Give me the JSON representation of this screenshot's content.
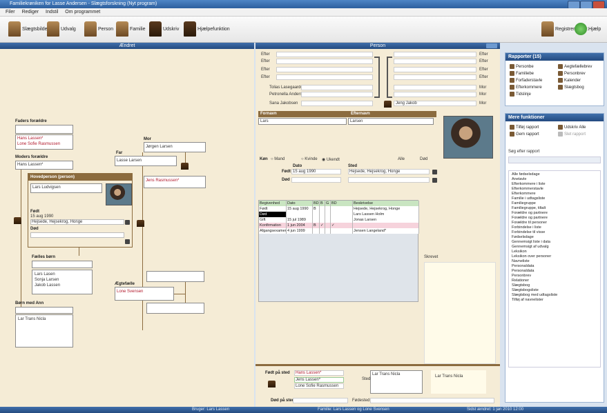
{
  "window": {
    "title": "Familiekrøniken for Lasse Andersen - Slægtsforskning (Nyt program)"
  },
  "menu": [
    "Filer",
    "Rediger",
    "Indstil",
    "Om programmet"
  ],
  "toolbar": {
    "items": [
      {
        "label": "Slægtsbilde",
        "icon": "family-tree-icon"
      },
      {
        "label": "Udvalg",
        "icon": "person-group-icon"
      },
      {
        "label": "Person",
        "icon": "person-icon"
      },
      {
        "label": "Familie",
        "icon": "family-icon"
      },
      {
        "label": "Udskriv",
        "icon": "print-icon"
      },
      {
        "label": "Hjælpefunktion",
        "icon": "help-book-icon"
      }
    ],
    "right_items": [
      {
        "label": "Registrer ændr.",
        "icon": "register-icon"
      },
      {
        "label": "Hjælp",
        "icon": "green-help-icon"
      }
    ]
  },
  "left_panel": {
    "header": "Ændret",
    "father_parents_label": "Faders forældre",
    "father_parents": {
      "empty": "",
      "child_line1": "Hans Lassen*",
      "child_line2": "Lone Sofie Rasmussen"
    },
    "mother_parents_label": "Moders forældre",
    "mother_parents_value": "Hans Lassen*",
    "mother_label": "Mor",
    "mother_name": "Jørgen Larsen",
    "father_label": "Far",
    "father_name": "Lasse Larsen",
    "partner_top_name": "Jens Rasmussen*",
    "focus_header": "Hovedperson (person)",
    "focus_name": "Lars Ludvigsen",
    "born_label": "Født",
    "born_value": "15 aug 1990",
    "born_place": "Hejsede, Hejsekrog, Honge",
    "died_label": "Død",
    "children_label": "Fælles børn",
    "children": [
      "Lars Lasen",
      "Sonja Larsen",
      "Jakob Lassen"
    ],
    "partner_label": "Ægtefælle",
    "partner_name": "Lone Svensen",
    "siblings_label": "Børn med Ann",
    "siblings": [
      "Lar Trans Nicla"
    ]
  },
  "center_panel": {
    "header": "Person",
    "name_fields": [
      {
        "label": "Efter",
        "right": "Efter"
      },
      {
        "label": "Efter",
        "right": "Efter"
      },
      {
        "label": "Efter",
        "right": "Efter"
      },
      {
        "label": "Efter",
        "right": "Efter"
      }
    ],
    "couple_rows": [
      {
        "left": "Tolias Lasegaarde",
        "right": "Mor"
      },
      {
        "left": "Petronella Andersen",
        "right": "Mor"
      }
    ],
    "partner_field": "Sana Jakobsen",
    "partner_right": "Jeng Jakob",
    "partner_right2": "Mor",
    "first_name_label": "Fornavn",
    "first_name_value": "Lars",
    "last_name_label": "Efternavn",
    "last_name_value": "Larsen",
    "sex_label": "Køn",
    "sex_options": [
      "Mand",
      "Kvinde",
      "Ukendt"
    ],
    "sex_selected": "Ukendt",
    "alive_label": "Alle",
    "alive_value": "Død",
    "date_label": "Dato",
    "born_label": "Født",
    "born_value": "15 aug 1990",
    "place_label": "Sted",
    "place_value": "Hejsede, Hejsekrog, Honge",
    "died_label": "Død",
    "events_headers": [
      "Begivenhed",
      "Dato",
      "BDS",
      "B",
      "G",
      "BD",
      "Beskrivelse"
    ],
    "events": [
      {
        "type": "Født",
        "date": "15 aug 1990",
        "c1": "B",
        "c2": "",
        "c3": "",
        "c4": "",
        "desc": "Hejsede, Hejsekrog, Honge",
        "style": "normal"
      },
      {
        "type": "Død",
        "date": "",
        "c1": "",
        "c2": "",
        "c3": "",
        "c4": "",
        "desc": "Lars Lassen Holm",
        "style": "selected"
      },
      {
        "type": "Gift",
        "date": "15 jul 1989",
        "c1": "",
        "c2": "",
        "c3": "",
        "c4": "",
        "desc": "Jonas Larsen",
        "style": "normal"
      },
      {
        "type": "Konfirmation",
        "date": "1 jun 2004",
        "c1": "B",
        "c2": "✓",
        "c3": "",
        "c4": "✓",
        "desc": "",
        "style": "pink"
      },
      {
        "type": "Afgangsexamen",
        "date": "4 jun 1999",
        "c1": "",
        "c2": "",
        "c3": "",
        "c4": "",
        "desc": "Jensen Langeland*",
        "style": "normal"
      }
    ],
    "note_label": "Skrevet",
    "bottom_label1": "Født på sted",
    "bottom_label2": "Død på sted",
    "bottom_name1": "Hans Lassen*",
    "bottom_name2": "Jens Lassen*",
    "bottom_name3": "Lone Sofie Rasmussen",
    "bottom_mid_label": "Sted",
    "bottom_mid_value": "Lar Trans Nicla",
    "bottom_right_value": "Lar Trans Nicla",
    "bottom_label3": "Fødested"
  },
  "right_panel": {
    "reports_header": "Rapporter (15)",
    "reports_left": [
      "Personbe",
      "Familiebe",
      "Forfaderstavle",
      "Efterkommere",
      "Tidslinje"
    ],
    "reports_right": [
      "Aegtefællebrev",
      "Personbrev",
      "Kalender",
      "Slægtsbog"
    ],
    "tools_header": "Mere funktioner",
    "tools": [
      {
        "label": "Tilføj rapport",
        "icon": "add-report-icon"
      },
      {
        "label": "Udskriv Alle",
        "icon": "print-all-icon"
      },
      {
        "label": "Gem rapport",
        "icon": "save-report-icon"
      },
      {
        "label": "Slet rapport",
        "icon": "delete-report-icon"
      }
    ],
    "search_label": "Søg efter rapport",
    "list": [
      "Alle fødselsdage",
      "Anetavle",
      "Efterkommere i liste",
      "Efterkommerstavle",
      "Efterkommere",
      "Familie i udtagsliste",
      "Familiegruppe",
      "Familiegruppe, tiltalt",
      "Forældre og partnere",
      "Forældre og partnere",
      "Forældre til personer",
      "Forbindelse i liste",
      "Forbindelse til visse",
      "Fødselsdage",
      "Gennemsigt liste i data",
      "Gennemsigt af udvalg",
      "Leksikon",
      "Leksikon over personer",
      "Navneliste",
      "Personaldata",
      "Personaldata",
      "Personbrev",
      "Relationer",
      "Slægtsbog",
      "Slægtsbogsliste",
      "Slægtsbog med udtagsliste",
      "Tilføj af navnelister"
    ]
  },
  "statusbar": {
    "left": "Bruger: Lars Lassen",
    "mid": "Familie: Lars Lassen og Lone Svensen",
    "right": "Sidst ændret: 1 jan 2010 12:00"
  }
}
